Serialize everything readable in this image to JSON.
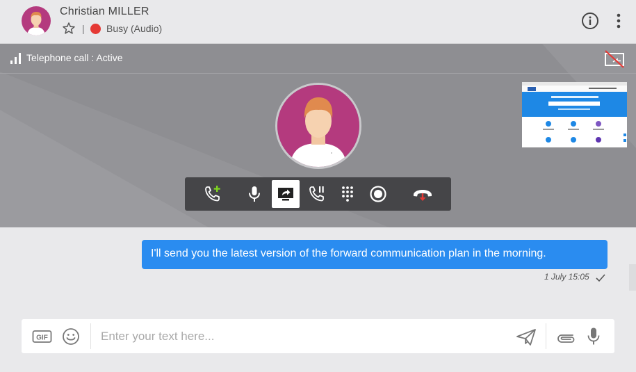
{
  "header": {
    "contact_name": "Christian MILLER",
    "separator": "|",
    "status_text": "Busy (Audio)",
    "status_color": "#e53935",
    "icons": [
      "star-icon",
      "info-icon",
      "more-vertical-icon"
    ]
  },
  "call": {
    "status": "Telephone call : Active",
    "avatar_color": "#b43a7e",
    "controls": [
      {
        "name": "add-call",
        "icon": "phone-plus-icon"
      },
      {
        "name": "microphone",
        "icon": "microphone-icon"
      },
      {
        "name": "screen-share",
        "icon": "screen-share-icon",
        "active": true
      },
      {
        "name": "hold",
        "icon": "phone-pause-icon"
      },
      {
        "name": "dialpad",
        "icon": "dialpad-icon"
      },
      {
        "name": "record",
        "icon": "record-icon"
      },
      {
        "name": "hang-up",
        "icon": "hang-up-icon"
      }
    ]
  },
  "messages": [
    {
      "text": "I'll send you the latest version of the forward communication plan in the morning.",
      "time": "1 July 15:05",
      "bubble_color": "#2a8cf0",
      "status_icon": "check-icon"
    }
  ],
  "composer": {
    "gif_label": "GIF",
    "placeholder": "Enter your text here...",
    "value": "",
    "icons": [
      "gif-icon",
      "emoji-icon",
      "send-icon",
      "paperclip-icon",
      "microphone-icon"
    ]
  }
}
